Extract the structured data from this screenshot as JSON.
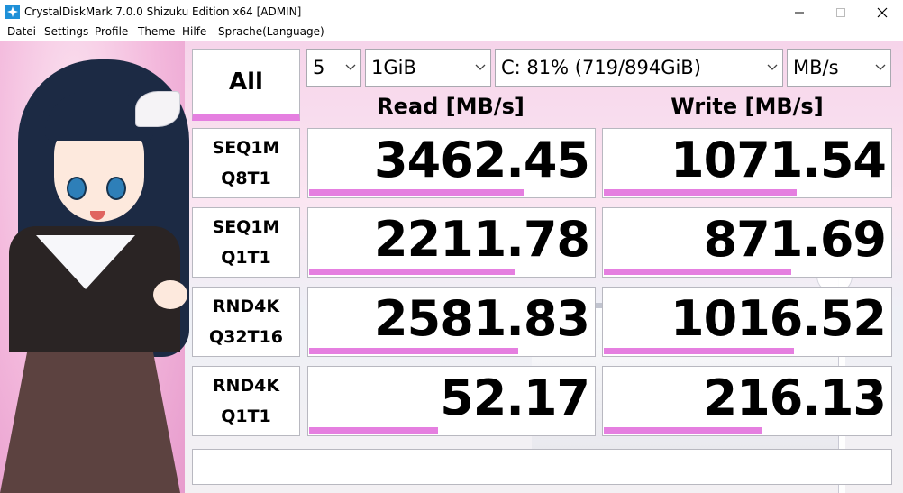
{
  "window": {
    "title": "CrystalDiskMark 7.0.0 Shizuku Edition x64 [ADMIN]",
    "icon": "app-icon"
  },
  "menu": {
    "items": [
      {
        "label": "Datei"
      },
      {
        "label": "Settings"
      },
      {
        "label": "Profile"
      },
      {
        "label": "Theme"
      },
      {
        "label": "Hilfe"
      },
      {
        "label": "Sprache(Language)"
      }
    ]
  },
  "controls": {
    "all_label": "All",
    "count": "5",
    "size": "1GiB",
    "drive": "C: 81% (719/894GiB)",
    "unit": "MB/s"
  },
  "headers": {
    "read": "Read [MB/s]",
    "write": "Write [MB/s]"
  },
  "tests": [
    {
      "line1": "SEQ1M",
      "line2": "Q8T1",
      "read": "3462.45",
      "write": "1071.54",
      "read_fill": 0.75,
      "write_fill": 0.67
    },
    {
      "line1": "SEQ1M",
      "line2": "Q1T1",
      "read": "2211.78",
      "write": "871.69",
      "read_fill": 0.72,
      "write_fill": 0.65
    },
    {
      "line1": "RND4K",
      "line2": "Q32T16",
      "read": "2581.83",
      "write": "1016.52",
      "read_fill": 0.73,
      "write_fill": 0.66
    },
    {
      "line1": "RND4K",
      "line2": "Q1T1",
      "read": "52.17",
      "write": "216.13",
      "read_fill": 0.45,
      "write_fill": 0.55
    }
  ],
  "status": "",
  "colors": {
    "accent": "#e57fe0"
  }
}
